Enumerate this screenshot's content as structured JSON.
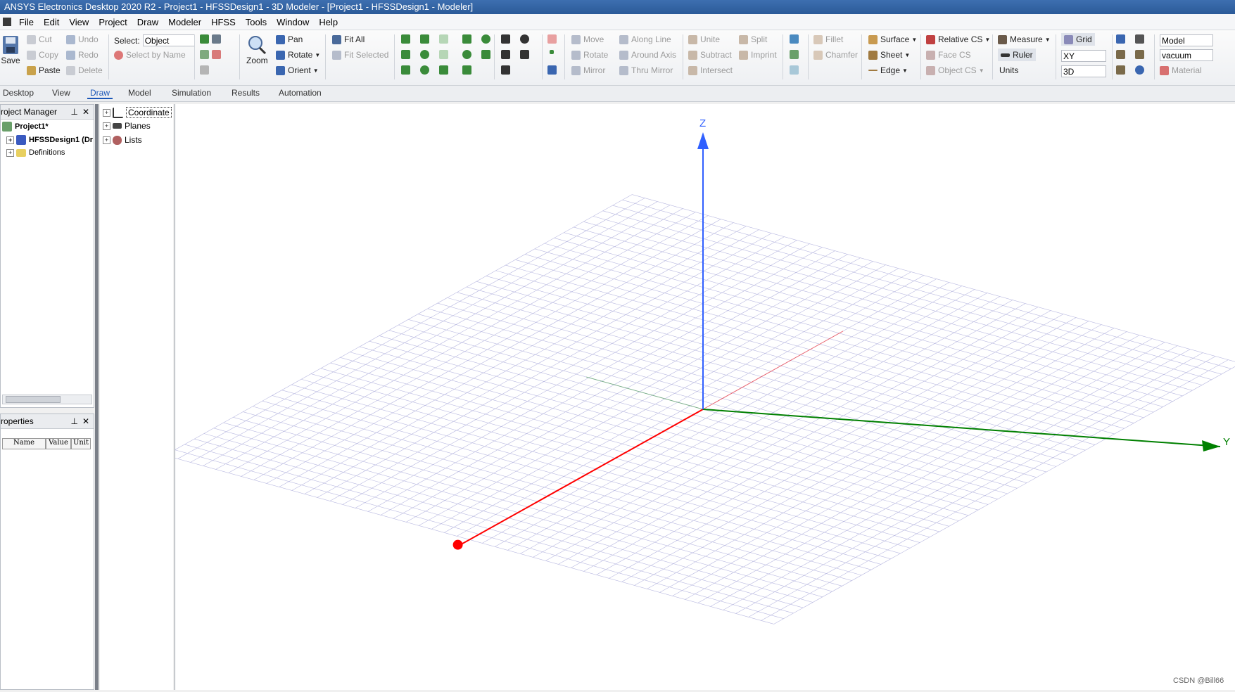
{
  "window": {
    "title": "ANSYS Electronics Desktop 2020 R2 - Project1 - HFSSDesign1 - 3D Modeler - [Project1 - HFSSDesign1 - Modeler]"
  },
  "menu": [
    "File",
    "Edit",
    "View",
    "Project",
    "Draw",
    "Modeler",
    "HFSS",
    "Tools",
    "Window",
    "Help"
  ],
  "ribbon": {
    "save": "Save",
    "cut": "Cut",
    "copy": "Copy",
    "paste": "Paste",
    "undo": "Undo",
    "redo": "Redo",
    "delete": "Delete",
    "select_label": "Select:",
    "select_value": "Object",
    "select_by_name": "Select by Name",
    "zoom": "Zoom",
    "pan": "Pan",
    "rotate": "Rotate",
    "orient": "Orient",
    "fit_all": "Fit All",
    "fit_selected": "Fit Selected",
    "move": "Move",
    "rotate_op": "Rotate",
    "mirror": "Mirror",
    "along_line": "Along Line",
    "around_axis": "Around Axis",
    "thru_mirror": "Thru Mirror",
    "unite": "Unite",
    "subtract": "Subtract",
    "intersect": "Intersect",
    "split": "Split",
    "imprint": "Imprint",
    "fillet": "Fillet",
    "chamfer": "Chamfer",
    "surface": "Surface",
    "sheet": "Sheet",
    "edge": "Edge",
    "relative_cs": "Relative CS",
    "face_cs": "Face CS",
    "object_cs": "Object CS",
    "measure": "Measure",
    "ruler": "Ruler",
    "units": "Units",
    "grid": "Grid",
    "plane_value": "XY",
    "dim_value": "3D",
    "model_value": "Model",
    "material_value": "vacuum",
    "material": "Material"
  },
  "tabs": [
    "Desktop",
    "View",
    "Draw",
    "Model",
    "Simulation",
    "Results",
    "Automation"
  ],
  "active_tab": "Draw",
  "project_manager": {
    "title": "roject Manager",
    "project": "Project1*",
    "design": "HFSSDesign1 (Dr",
    "definitions": "Definitions"
  },
  "properties": {
    "title": "roperties",
    "columns": [
      "Name",
      "Value",
      "Unit"
    ]
  },
  "model_tree": [
    "Coordinate",
    "Planes",
    "Lists"
  ],
  "axes": {
    "z": "Z",
    "y": "Y",
    "x_color": "#ff0000",
    "y_color": "#008000",
    "z_color": "#3060ff"
  },
  "watermark": "CSDN @Bill66",
  "colors": {
    "accent": "#1a56b8",
    "grid": "#b8b8e0"
  }
}
